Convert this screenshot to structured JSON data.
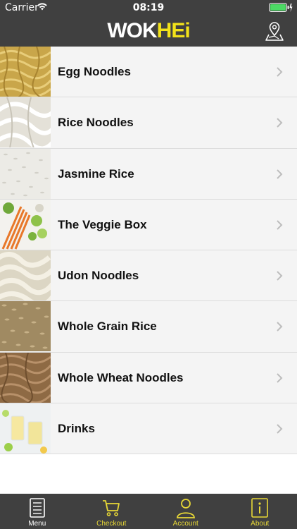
{
  "status_bar": {
    "carrier": "Carrier",
    "time": "08:19",
    "icons": [
      "wifi-icon",
      "battery-icon",
      "charging-icon"
    ]
  },
  "header": {
    "logo_part1": "WOK",
    "logo_part2": "HEi",
    "right_icon": "map-pin-icon"
  },
  "menu": {
    "items": [
      {
        "label": "Egg Noodles",
        "icon": "chevron-right-icon"
      },
      {
        "label": "Rice Noodles",
        "icon": "chevron-right-icon"
      },
      {
        "label": "Jasmine Rice",
        "icon": "chevron-right-icon"
      },
      {
        "label": "The Veggie Box",
        "icon": "chevron-right-icon"
      },
      {
        "label": "Udon Noodles",
        "icon": "chevron-right-icon"
      },
      {
        "label": "Whole Grain Rice",
        "icon": "chevron-right-icon"
      },
      {
        "label": "Whole Wheat Noodles",
        "icon": "chevron-right-icon"
      },
      {
        "label": "Drinks",
        "icon": "chevron-right-icon"
      }
    ]
  },
  "tab_bar": {
    "tabs": [
      {
        "label": "Menu",
        "icon": "menu-book-icon"
      },
      {
        "label": "Checkout",
        "icon": "cart-icon"
      },
      {
        "label": "Account",
        "icon": "user-icon"
      },
      {
        "label": "About",
        "icon": "info-icon"
      }
    ]
  },
  "colors": {
    "bar_background": "#404040",
    "accent_yellow": "#f2e21a",
    "row_background": "#f4f4f4"
  }
}
